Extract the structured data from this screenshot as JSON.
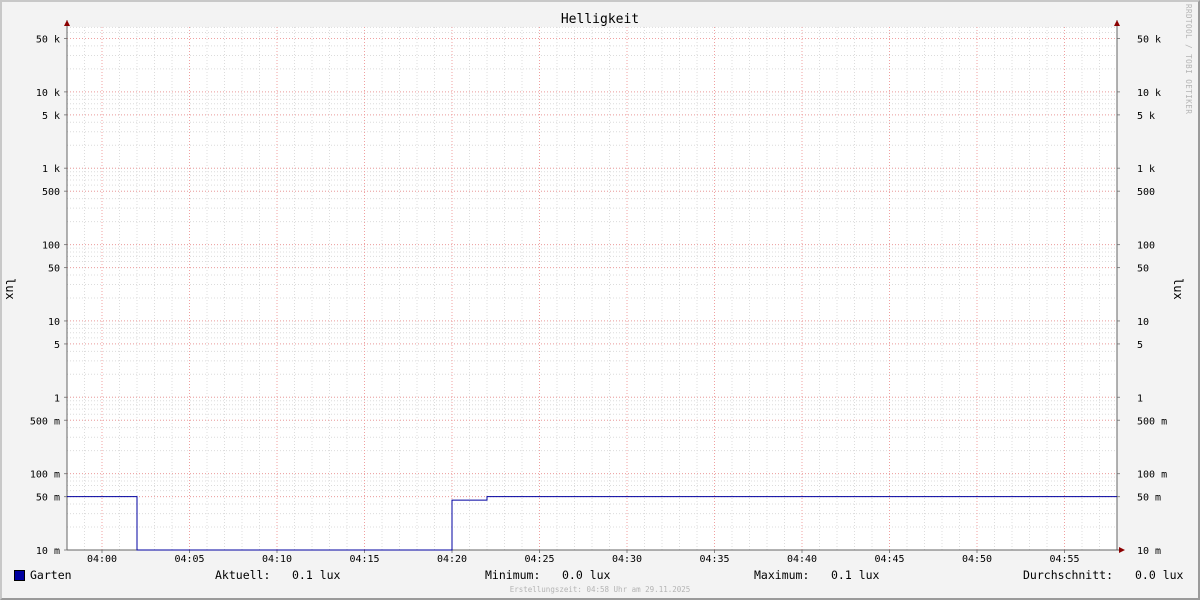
{
  "chart_data": {
    "type": "line",
    "title": "Helligkeit",
    "ylabel": "lux",
    "ylabel_right": "lux",
    "yscale": "log",
    "ylim": [
      0.01,
      80000
    ],
    "xlim": [
      "03:58",
      "04:58"
    ],
    "x_ticks": [
      "04:00",
      "04:05",
      "04:10",
      "04:15",
      "04:20",
      "04:25",
      "04:30",
      "04:35",
      "04:40",
      "04:45",
      "04:50",
      "04:55"
    ],
    "y_ticks": [
      {
        "value": 50000,
        "label": "50 k"
      },
      {
        "value": 10000,
        "label": "10 k"
      },
      {
        "value": 5000,
        "label": "5 k"
      },
      {
        "value": 1000,
        "label": "1 k"
      },
      {
        "value": 500,
        "label": "500"
      },
      {
        "value": 100,
        "label": "100"
      },
      {
        "value": 50,
        "label": "50"
      },
      {
        "value": 10,
        "label": "10"
      },
      {
        "value": 5,
        "label": "5"
      },
      {
        "value": 1,
        "label": "1"
      },
      {
        "value": 0.5,
        "label": "500 m"
      },
      {
        "value": 0.1,
        "label": "100 m"
      },
      {
        "value": 0.05,
        "label": "50 m"
      },
      {
        "value": 0.01,
        "label": "10 m"
      }
    ],
    "grid": true,
    "legend_position": "bottom-left",
    "series": [
      {
        "name": "Garten",
        "color": "#0000a0",
        "points": [
          {
            "x": "03:58",
            "y": 0.05
          },
          {
            "x": "04:02",
            "y": 0.05
          },
          {
            "x": "04:02",
            "y": 0.01
          },
          {
            "x": "04:20",
            "y": 0.01
          },
          {
            "x": "04:20",
            "y": 0.045
          },
          {
            "x": "04:22",
            "y": 0.045
          },
          {
            "x": "04:22",
            "y": 0.05
          },
          {
            "x": "04:58",
            "y": 0.05
          }
        ]
      }
    ]
  },
  "legend": {
    "series_name": "Garten",
    "current_label": "Aktuell:",
    "current_value": "0.1 lux",
    "min_label": "Minimum:",
    "min_value": "0.0 lux",
    "max_label": "Maximum:",
    "max_value": "0.1 lux",
    "avg_label": "Durchschnitt:",
    "avg_value": "0.0 lux"
  },
  "footer": "Erstellungszeit: 04:58 Uhr am 29.11.2025",
  "watermark": "RRDTOOL / TOBI OETIKER"
}
